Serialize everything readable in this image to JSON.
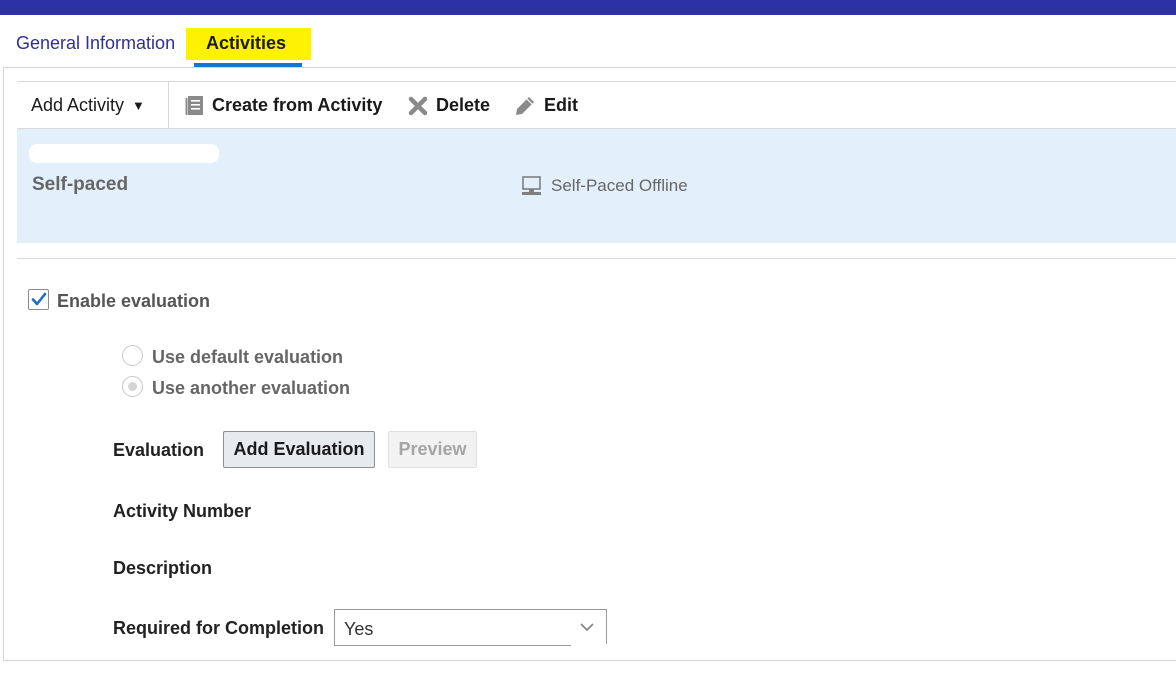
{
  "tabs": [
    {
      "label": "General Information",
      "active": false
    },
    {
      "label": "Activities",
      "active": true
    }
  ],
  "colors": {
    "topbar": "#2d31a6",
    "highlight": "#fff200",
    "tab_underline": "#1b76c9",
    "selected_row": "#e3f0fc"
  },
  "toolbar": {
    "add_activity": "Add Activity",
    "create_from_activity": "Create from Activity",
    "delete": "Delete",
    "edit": "Edit"
  },
  "activity": {
    "title": "Self-paced",
    "type": "Self-Paced Offline",
    "type_icon": "computer-icon"
  },
  "form": {
    "enable_evaluation": {
      "label": "Enable evaluation",
      "checked": true
    },
    "radio_options": [
      {
        "label": "Use default evaluation",
        "selected": false
      },
      {
        "label": "Use another evaluation",
        "selected": true
      }
    ],
    "evaluation_label": "Evaluation",
    "add_evaluation_button": "Add Evaluation",
    "preview_button": "Preview",
    "activity_number_label": "Activity Number",
    "description_label": "Description",
    "required_label": "Required for Completion",
    "required_value": "Yes"
  }
}
